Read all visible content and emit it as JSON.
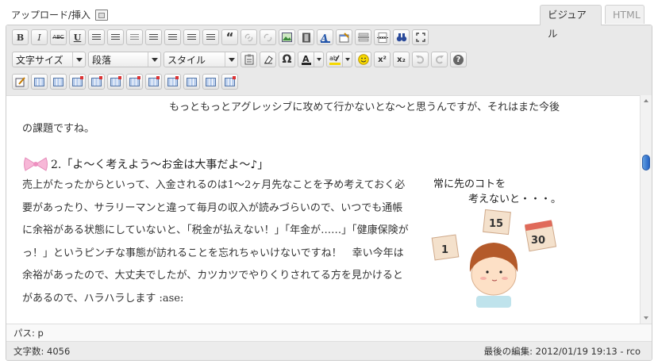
{
  "header": {
    "upload_label": "アップロード/挿入",
    "tabs": {
      "visual": "ビジュアル",
      "html": "HTML"
    }
  },
  "toolbar": {
    "bold": "B",
    "italic": "I",
    "strikethrough": "ABC",
    "underline": "U",
    "blockquote": "“",
    "omega": "Ω",
    "superscript": "x²",
    "subscript": "x₂",
    "help": "?",
    "font_size_select": "文字サイズ",
    "format_select": "段落",
    "style_select": "スタイル"
  },
  "content": {
    "paragraph1": "もっともっとアグレッシブに攻めて行かないとな〜と思うんですが、それはまた今後の課題ですね。",
    "heading": "2.「よ〜く考えよう〜お金は大事だよ〜♪」",
    "paragraph2": "売上がたったからといって、入金されるのは1〜2ヶ月先なことを予め考えておく必要があったり、サラリーマンと違って毎月の収入が読みづらいので、いつでも通帳に余裕がある状態にしていないと、「税金が払えない！」「年金が……」「健康保険がっ！」というピンチな事態が訪れることを忘れちゃいけないですね！　幸い今年は余裕があったので、大丈夫でしたが、カツカツでやりくりされてる方を見かけるとがあるので、ハラハラします :ase:",
    "illustration": {
      "caption_line1": "常に先のコトを",
      "caption_line2": "考えないと・・・。",
      "card1": "1",
      "card2": "15",
      "card3": "30"
    }
  },
  "path_bar": {
    "text": "パス: p"
  },
  "status_bar": {
    "word_count": "文字数: 4056",
    "last_edit": "最後の編集: 2012/01/19 19:13 - rco"
  }
}
